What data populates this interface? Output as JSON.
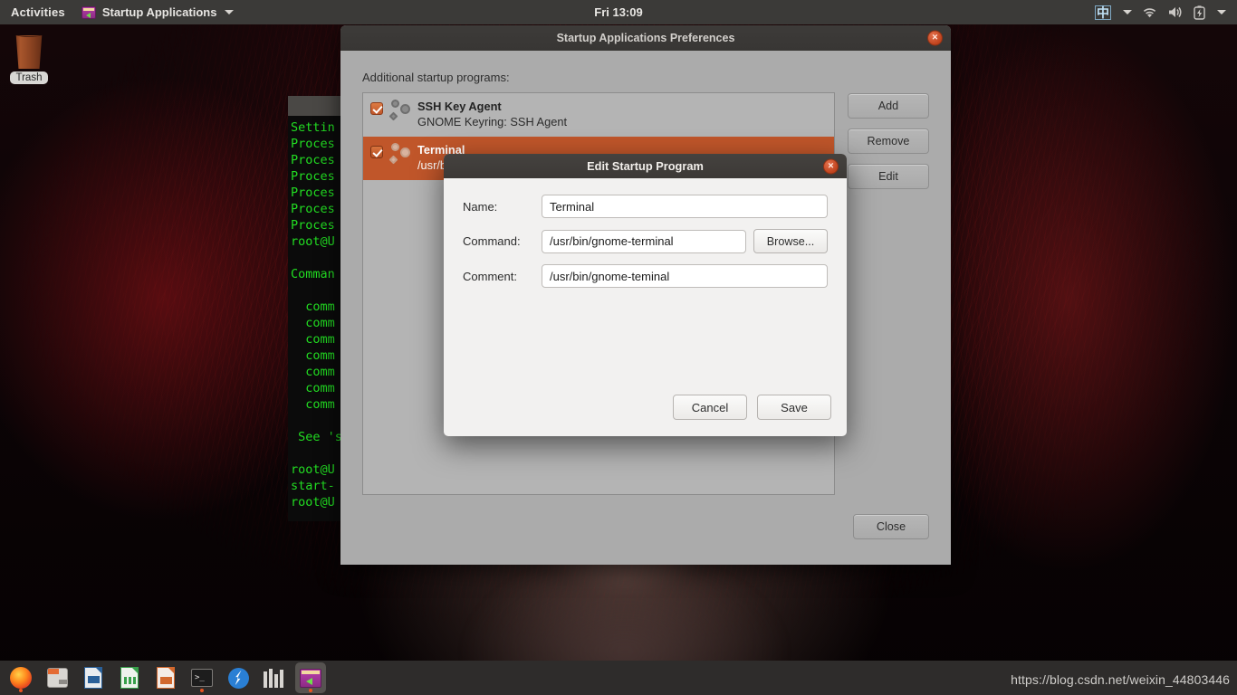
{
  "topbar": {
    "activities": "Activities",
    "app_name": "Startup Applications",
    "app_icon": "startup-applications-icon",
    "clock": "Fri 13:09",
    "ime": "中",
    "indicators": [
      "wifi-icon",
      "volume-icon",
      "battery-icon"
    ]
  },
  "desktop": {
    "trash_label": "Trash",
    "trash_icon": "trash-icon"
  },
  "terminal": {
    "lines": [
      "Settin",
      "Proces",
      "Proces",
      "Proces",
      "Proces",
      "Proces",
      "Proces",
      "root@U",
      "",
      "Comman",
      "",
      "  comm",
      "  comm",
      "  comm",
      "  comm",
      "  comm",
      "  comm",
      "  comm",
      "",
      " See 's",
      "",
      "root@U",
      "start-",
      "root@U"
    ]
  },
  "prefs_window": {
    "title": "Startup Applications Preferences",
    "close_glyph": "×",
    "section_label": "Additional startup programs:",
    "programs": [
      {
        "name": "SSH Key Agent",
        "description": "GNOME Keyring: SSH Agent",
        "checked": true,
        "selected": false
      },
      {
        "name": "Terminal",
        "description": "/usr/b",
        "checked": true,
        "selected": true
      }
    ],
    "buttons": {
      "add": "Add",
      "remove": "Remove",
      "edit": "Edit",
      "close": "Close"
    }
  },
  "edit_dialog": {
    "title": "Edit Startup Program",
    "close_glyph": "×",
    "fields": [
      {
        "label": "Name:",
        "value": "Terminal",
        "placeholder": ""
      },
      {
        "label": "Command:",
        "value": "/usr/bin/gnome-terminal",
        "placeholder": ""
      },
      {
        "label": "Comment:",
        "value": "/usr/bin/gnome-teminal",
        "placeholder": ""
      }
    ],
    "browse_label": "Browse...",
    "cancel_label": "Cancel",
    "save_label": "Save"
  },
  "dock": {
    "items": [
      {
        "icon": "firefox-icon",
        "running": true,
        "active": false
      },
      {
        "icon": "files-icon",
        "running": false,
        "active": false
      },
      {
        "icon": "libreoffice-writer-icon",
        "running": false,
        "active": false
      },
      {
        "icon": "libreoffice-calc-icon",
        "running": false,
        "active": false
      },
      {
        "icon": "libreoffice-impress-icon",
        "running": false,
        "active": false
      },
      {
        "icon": "terminal-icon",
        "running": true,
        "active": false
      },
      {
        "icon": "software-updater-icon",
        "running": false,
        "active": false
      },
      {
        "icon": "help-books-icon",
        "running": false,
        "active": false
      },
      {
        "icon": "startup-applications-icon",
        "running": true,
        "active": true
      }
    ]
  },
  "watermark": {
    "text": "https://blog.csdn.net/weixin_44803446"
  },
  "colors": {
    "ubuntu_orange": "#e95420",
    "selection_orange": "#c0562a",
    "topbar_bg": "#3b3a38",
    "window_bg": "#ababab",
    "dialog_bg": "#f2f1f0",
    "list_bg": "#b4b4b4",
    "terminal_green": "#22dd22"
  }
}
